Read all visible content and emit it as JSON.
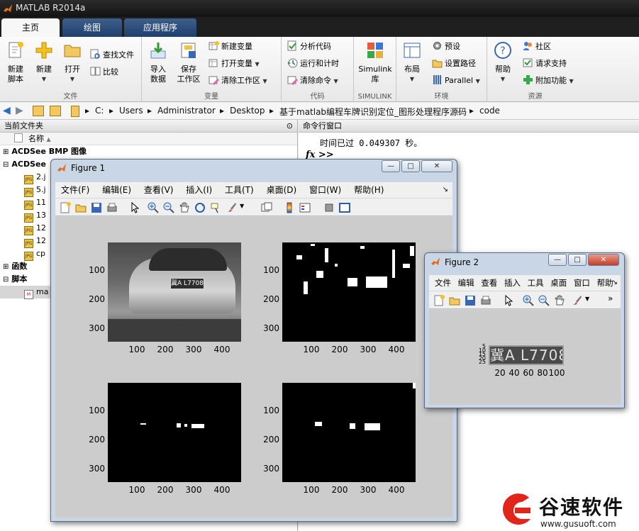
{
  "window": {
    "title": "MATLAB R2014a"
  },
  "tabs": [
    {
      "label": "主页",
      "active": true
    },
    {
      "label": "绘图",
      "active": false
    },
    {
      "label": "应用程序",
      "active": false
    }
  ],
  "ribbon": {
    "file": {
      "label": "文件",
      "new_script": "新建\n脚本",
      "new": "新建",
      "open": "打开",
      "find_files": "查找文件",
      "compare": "比较"
    },
    "variable": {
      "label": "变量",
      "import": "导入\n数据",
      "save": "保存\n工作区",
      "new_var": "新建变量",
      "open_var": "打开变量",
      "clear_ws": "清除工作区"
    },
    "code": {
      "label": "代码",
      "analyze": "分析代码",
      "run_time": "运行和计时",
      "clear_cmds": "清除命令"
    },
    "simulink": {
      "label": "SIMULINK",
      "lib": "Simulink\n库"
    },
    "env": {
      "label": "环境",
      "layout": "布局",
      "prefs": "预设",
      "set_path": "设置路径",
      "parallel": "Parallel"
    },
    "resources": {
      "label": "资源",
      "help": "帮助",
      "community": "社区",
      "support": "请求支持",
      "addons": "附加功能"
    }
  },
  "address": {
    "parts": [
      "C:",
      "Users",
      "Administrator",
      "Desktop",
      "基于matlab编程车牌识别定位_图形处理程序源码",
      "code"
    ]
  },
  "left_panel": {
    "title": "当前文件夹",
    "column": "名称",
    "rows": [
      {
        "label": "ACDSee BMP 图像",
        "indent": 0,
        "expand": "+"
      },
      {
        "label": "ACDSee",
        "indent": 0,
        "expand": "-"
      },
      {
        "label": "2.j",
        "indent": 1,
        "icon": "JPG"
      },
      {
        "label": "5.j",
        "indent": 1,
        "icon": "JPG"
      },
      {
        "label": "11",
        "indent": 1,
        "icon": "JPG"
      },
      {
        "label": "13",
        "indent": 1,
        "icon": "JPG"
      },
      {
        "label": "12",
        "indent": 1,
        "icon": "JPG"
      },
      {
        "label": "12",
        "indent": 1,
        "icon": "JPG"
      },
      {
        "label": "cp",
        "indent": 1,
        "icon": "JPG"
      },
      {
        "label": "函数",
        "indent": 0,
        "expand": "+"
      },
      {
        "label": "脚本",
        "indent": 0,
        "expand": "-"
      },
      {
        "label": "ma",
        "indent": 1,
        "icon": "M",
        "selected": true
      }
    ]
  },
  "command_window": {
    "title": "命令行窗口",
    "output": "时间已过 0.049307 秒。",
    "prompt": "fx >>"
  },
  "figure1": {
    "title": "Figure 1",
    "menu": [
      "文件(F)",
      "编辑(E)",
      "查看(V)",
      "插入(I)",
      "工具(T)",
      "桌面(D)",
      "窗口(W)",
      "帮助(H)"
    ],
    "yticks": [
      "100",
      "200",
      "300"
    ],
    "xticks": [
      "100",
      "200",
      "300",
      "400"
    ],
    "plate_text": "冀A L7708"
  },
  "figure2": {
    "title": "Figure 2",
    "menu": [
      "文件",
      "编辑",
      "查看",
      "插入",
      "工具",
      "桌面",
      "窗口",
      "帮助"
    ],
    "yticks": [
      "5",
      "10",
      "15",
      "20",
      "25"
    ],
    "xticks": [
      "20",
      "40",
      "60",
      "80",
      "100"
    ],
    "plate_text": "冀A L7708"
  },
  "watermark": {
    "brand": "谷速软件",
    "url": "www.gusuoft.com"
  }
}
